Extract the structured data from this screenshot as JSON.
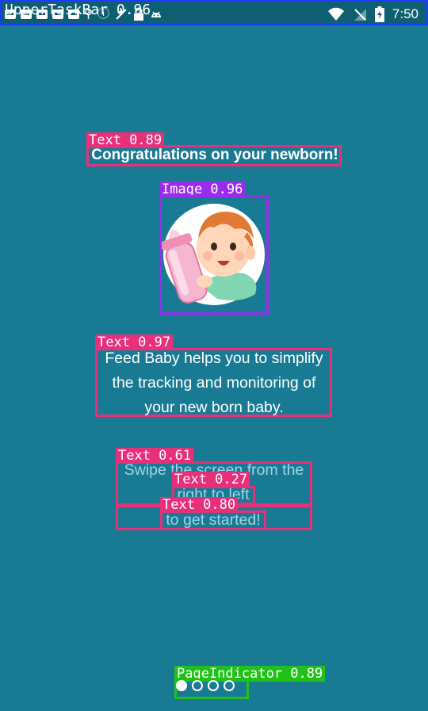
{
  "status_bar": {
    "overlay_label": "UpperTaskBar 0.96",
    "time": "7:50",
    "icons": [
      "notification-icon",
      "location-icon",
      "no-sim-icon",
      "lock-icon",
      "android-icon",
      "wifi-icon",
      "signal-icon",
      "battery-icon"
    ]
  },
  "annotations": {
    "heading_tag": "Text 0.89",
    "image_tag": "Image 0.96",
    "desc_tag": "Text 0.97",
    "hint1_tag": "Text 0.61",
    "hint2_tag": "Text 0.27",
    "hint3_tag": "Text 0.80",
    "indicator_tag": "PageIndicator 0.89"
  },
  "content": {
    "heading": "Congratulations on your newborn!",
    "description": "Feed Baby helps you to simplify the tracking and monitoring of your new born baby.",
    "hint_line1": "Swipe the screen from the",
    "hint_line2": "right to left",
    "hint_line3": "to get started!",
    "image_subject": "baby-with-bottle-illustration"
  },
  "page_indicator": {
    "total_pages": 4,
    "active_page": 1
  },
  "colors": {
    "background": "#197a94",
    "status_bar": "#0f5f73",
    "annotation_text": "#e8307a",
    "annotation_image": "#9c2bf0",
    "annotation_indicator": "#20c21a",
    "annotation_taskbar": "#1e3cff"
  }
}
